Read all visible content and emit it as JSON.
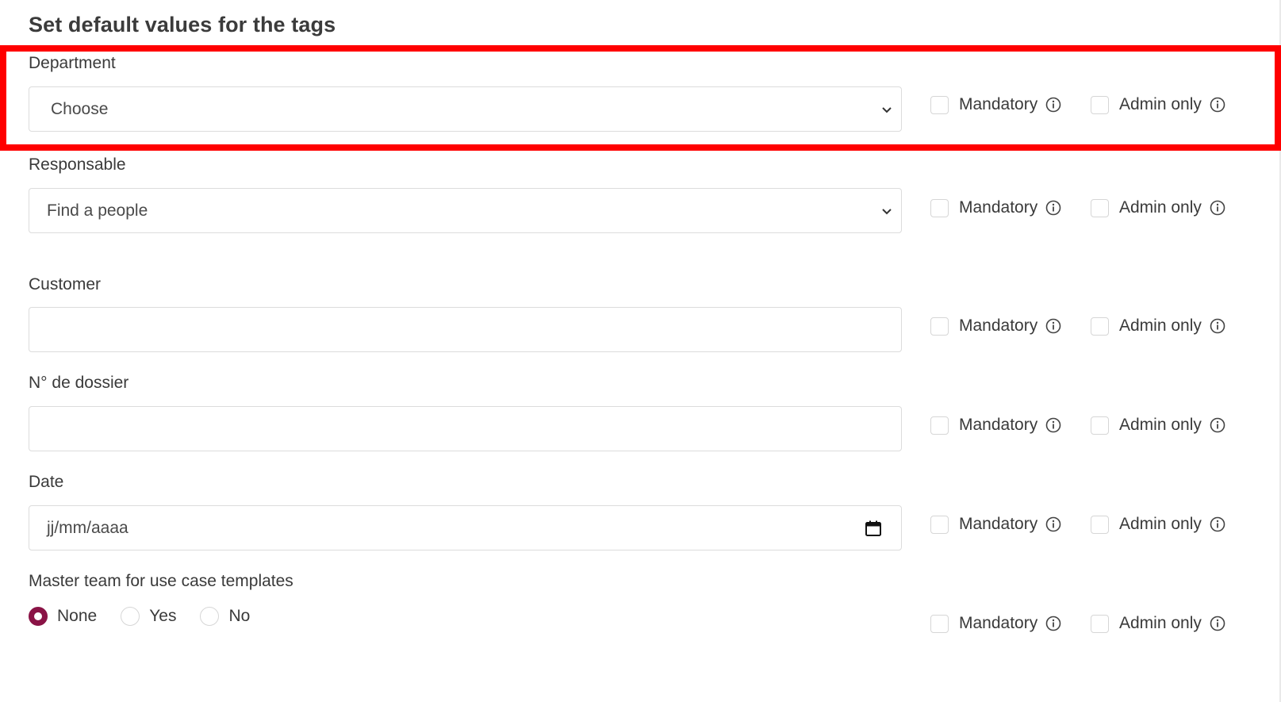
{
  "title": "Set default values for the tags",
  "option_labels": {
    "mandatory": "Mandatory",
    "admin_only": "Admin only"
  },
  "fields": {
    "department": {
      "label": "Department",
      "value": "Choose"
    },
    "responsable": {
      "label": "Responsable",
      "value": "Find a people"
    },
    "customer": {
      "label": "Customer",
      "value": ""
    },
    "dossier": {
      "label": "N° de dossier",
      "value": ""
    },
    "date": {
      "label": "Date",
      "value": "jj/mm/aaaa"
    },
    "master_team": {
      "label": "Master team for use case templates",
      "options": [
        "None",
        "Yes",
        "No"
      ],
      "selected": "None"
    }
  },
  "colors": {
    "accent": "#8a1346",
    "highlight": "#ff0000"
  },
  "icons": {
    "select": "chevron-down-icon",
    "date": "calendar-icon",
    "help": "info-icon"
  }
}
